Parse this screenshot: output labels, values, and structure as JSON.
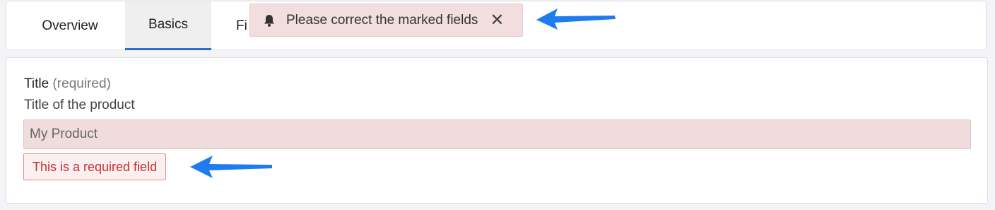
{
  "tabs": [
    {
      "label": "Overview"
    },
    {
      "label": "Basics",
      "active": true
    },
    {
      "label": "Fi"
    }
  ],
  "toast": {
    "message": "Please correct the marked fields",
    "icon": "bell-icon",
    "close_icon": "close-icon",
    "background": "#f2dedf"
  },
  "form": {
    "title_label": "Title",
    "required_note": "(required)",
    "description": "Title of the product",
    "input_value": "My Product",
    "error_message": "This is a required field"
  },
  "colors": {
    "accent": "#2d6fc6",
    "error_text": "#c9302c",
    "annotation_arrow": "#1f7cf0"
  }
}
